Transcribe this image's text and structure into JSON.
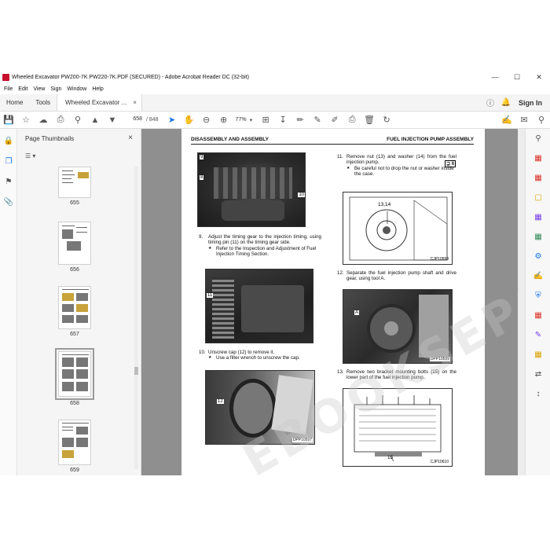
{
  "window": {
    "title": "Wheeled Excavator PW200-7K PW220-7K.PDF (SECURED) - Adobe Acrobat Reader DC (32-bit)",
    "minimize": "—",
    "maximize": "☐",
    "close": "✕"
  },
  "menu": [
    "File",
    "Edit",
    "View",
    "Sign",
    "Window",
    "Help"
  ],
  "tabs": {
    "home": "Home",
    "tools": "Tools",
    "document": "Wheeled Excavator ...",
    "close": "×",
    "sign_in": "Sign In"
  },
  "toolbar": {
    "current_page": "658",
    "total_pages": "/ 848",
    "zoom": "77%"
  },
  "thumbnail_panel": {
    "title": "Page Thumbnails",
    "close": "×",
    "options": "☰ ▾",
    "pages": [
      "655",
      "656",
      "657",
      "658",
      "659"
    ],
    "selected_page": "658"
  },
  "document_page": {
    "header_left": "DISASSEMBLY AND ASSEMBLY",
    "header_right": "FUEL INJECTION PUMP ASSEMBLY",
    "watermark": "EBOOKSEPO.COM",
    "left_photo_callouts": {
      "top": "9",
      "left": "8",
      "right": "10"
    },
    "step9": {
      "num": "9.",
      "text": "Adjust the timing gear to the injection timing, using timing pin (11) on the timing gear side.",
      "note": "Refer to the Inspection and Adjustment of Fuel Injection Timing Section."
    },
    "photo2_callout": "11",
    "step10": {
      "num": "10.",
      "text": "Unscrew cap (12) to remove it.",
      "note": "Use a filter wrench to unscrew the cap."
    },
    "photo3_callout": "12",
    "photo3_code": "DPP10597",
    "step11": {
      "num": "11.",
      "text": "Remove nut (13) and washer (14) from the fuel injection pump.",
      "tool": "⊒ 6",
      "note": "Be careful not to drop the nut or washer inside the case."
    },
    "drawing1_callout": "13,14",
    "drawing1_code": "CJP10598",
    "step12": {
      "num": "12.",
      "text": "Separate the fuel injection pump shaft and drive gear, using tool A."
    },
    "photo4_callout": "A",
    "photo4_code": "DPP10599",
    "step13": {
      "num": "13.",
      "text": "Remove two bracket mounting bolts (15) on the lower part of the fuel injection pump."
    },
    "drawing2_callout": "15",
    "drawing2_code": "CJP10610"
  }
}
